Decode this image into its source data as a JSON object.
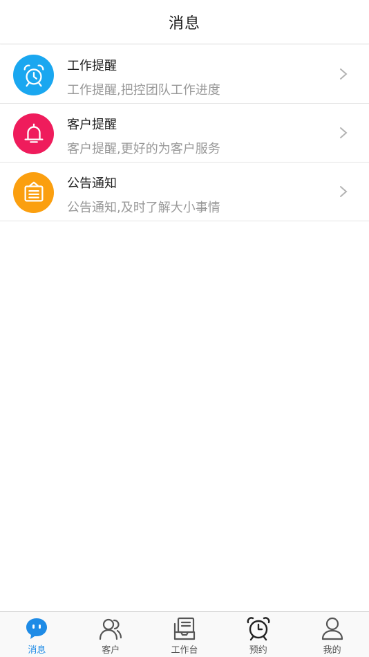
{
  "header": {
    "title": "消息"
  },
  "colors": {
    "blue": "#1aa7f0",
    "red": "#ef1c5c",
    "orange": "#fb9f0f",
    "active": "#1e8be6"
  },
  "messages": [
    {
      "title": "工作提醒",
      "subtitle": "工作提醒,把控团队工作进度",
      "icon": "alarm-clock-icon"
    },
    {
      "title": "客户提醒",
      "subtitle": "客户提醒,更好的为客户服务",
      "icon": "bell-icon"
    },
    {
      "title": "公告通知",
      "subtitle": "公告通知,及时了解大小事情",
      "icon": "notice-board-icon"
    }
  ],
  "tabs": [
    {
      "label": "消息",
      "icon": "chat-bubble-icon",
      "active": true
    },
    {
      "label": "客户",
      "icon": "customers-icon",
      "active": false
    },
    {
      "label": "工作台",
      "icon": "workbench-icon",
      "active": false
    },
    {
      "label": "预约",
      "icon": "alarm-clock-icon",
      "active": false
    },
    {
      "label": "我的",
      "icon": "user-icon",
      "active": false
    }
  ]
}
